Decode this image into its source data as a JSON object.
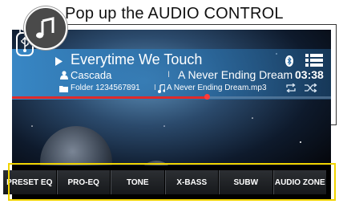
{
  "callout": {
    "icon": "music-note-icon",
    "text": "Pop up the AUDIO CONTROL"
  },
  "now_playing": {
    "source_icon": "usb-icon",
    "play_icon": "play-icon",
    "title": "Everytime We Touch",
    "artist_icon": "person-icon",
    "artist": "Cascada",
    "separator": "I",
    "album": "A Never Ending Dream",
    "time": "03:38",
    "folder_icon": "folder-icon",
    "folder": "Folder 1234567891",
    "file_icon": "music-file-icon",
    "filename": "A Never Ending Dream.mp3",
    "bluetooth_icon": "bluetooth-icon",
    "list_icon": "list-icon",
    "repeat_icon": "repeat-icon",
    "shuffle_icon": "shuffle-icon",
    "progress_fraction": 0.61
  },
  "audio_tabs": [
    {
      "label": "PRESET EQ"
    },
    {
      "label": "PRO-EQ"
    },
    {
      "label": "TONE"
    },
    {
      "label": "X-BASS"
    },
    {
      "label": "SUBW"
    },
    {
      "label": "AUDIO ZONE"
    }
  ],
  "colors": {
    "accent_yellow": "#f1d400",
    "progress_red": "#e02a2a",
    "info_panel_blue": "#2f7fbf"
  }
}
